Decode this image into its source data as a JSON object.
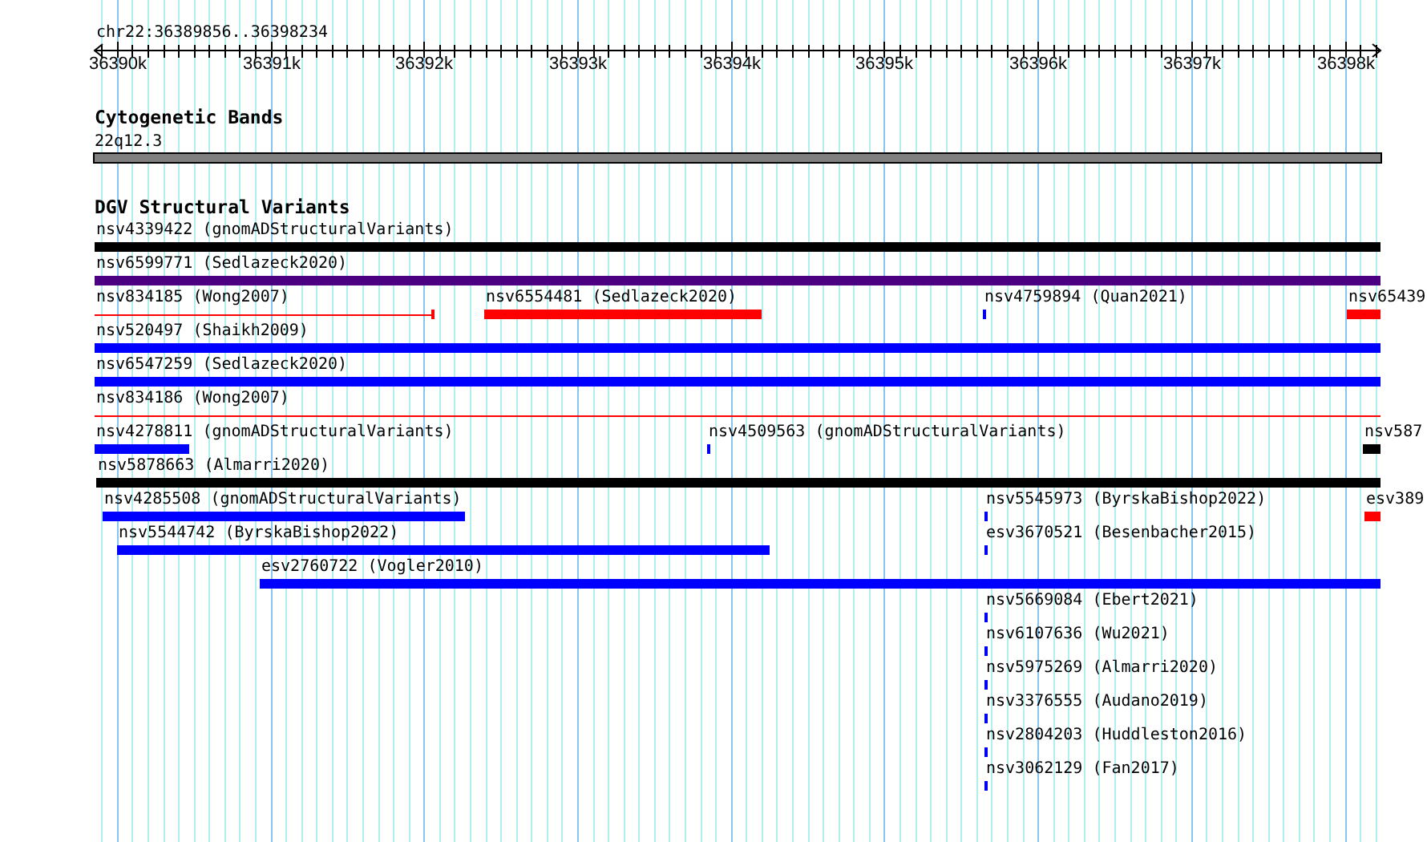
{
  "location": "chr22:36389856..36398234",
  "ruler": {
    "ticks": [
      "36390k",
      "36391k",
      "36392k",
      "36393k",
      "36394k",
      "36395k",
      "36396k",
      "36397k",
      "36398k"
    ]
  },
  "tracks": [
    {
      "kind": "bands",
      "title": "Cytogenetic Bands",
      "bands": [
        {
          "name": "22q12.3"
        }
      ]
    },
    {
      "kind": "features",
      "title": "DGV Structural Variants",
      "rows": [
        {
          "features": [
            {
              "label": "nsv4339422 (gnomADStructuralVariants)",
              "kind": "bar",
              "color": "#000000"
            }
          ]
        },
        {
          "features": [
            {
              "label": "nsv6599771 (Sedlazeck2020)",
              "kind": "bar",
              "color": "#4b0082"
            }
          ]
        },
        {
          "features": [
            {
              "label": "nsv834185 (Wong2007)",
              "kind": "line",
              "color": "#ff0000"
            },
            {
              "label": "nsv6554481 (Sedlazeck2020)",
              "kind": "bar",
              "color": "#ff0000"
            },
            {
              "label": "nsv4759894 (Quan2021)",
              "kind": "bar",
              "color": "#0000ff"
            },
            {
              "label": "nsv65439",
              "kind": "bar",
              "color": "#ff0000"
            }
          ]
        },
        {
          "features": [
            {
              "label": "nsv520497 (Shaikh2009)",
              "kind": "bar",
              "color": "#0000ff"
            }
          ]
        },
        {
          "features": [
            {
              "label": "nsv6547259 (Sedlazeck2020)",
              "kind": "bar",
              "color": "#0000ff"
            }
          ]
        },
        {
          "features": [
            {
              "label": "nsv834186 (Wong2007)",
              "kind": "line",
              "color": "#ff0000"
            }
          ]
        },
        {
          "features": [
            {
              "label": "nsv4278811 (gnomADStructuralVariants)",
              "kind": "bar",
              "color": "#0000ff"
            },
            {
              "label": "nsv4509563 (gnomADStructuralVariants)",
              "kind": "bar",
              "color": "#0000ff"
            },
            {
              "label": "nsv587",
              "kind": "bar",
              "color": "#000000"
            }
          ]
        },
        {
          "features": [
            {
              "label": "nsv5878663 (Almarri2020)",
              "kind": "bar",
              "color": "#000000"
            }
          ]
        },
        {
          "features": [
            {
              "label": "nsv4285508 (gnomADStructuralVariants)",
              "kind": "bar",
              "color": "#0000ff"
            },
            {
              "label": "nsv5545973 (ByrskaBishop2022)",
              "kind": "bar",
              "color": "#0000ff"
            },
            {
              "label": "esv389",
              "kind": "bar",
              "color": "#ff0000"
            }
          ]
        },
        {
          "features": [
            {
              "label": "nsv5544742 (ByrskaBishop2022)",
              "kind": "bar",
              "color": "#0000ff"
            },
            {
              "label": "esv3670521 (Besenbacher2015)",
              "kind": "bar",
              "color": "#0000ff"
            }
          ]
        },
        {
          "features": [
            {
              "label": "esv2760722 (Vogler2010)",
              "kind": "bar",
              "color": "#0000ff"
            }
          ]
        },
        {
          "features": [
            {
              "label": "nsv5669084 (Ebert2021)",
              "kind": "bar",
              "color": "#0000ff"
            }
          ]
        },
        {
          "features": [
            {
              "label": "nsv6107636 (Wu2021)",
              "kind": "bar",
              "color": "#0000ff"
            }
          ]
        },
        {
          "features": [
            {
              "label": "nsv5975269 (Almarri2020)",
              "kind": "bar",
              "color": "#0000ff"
            }
          ]
        },
        {
          "features": [
            {
              "label": "nsv3376555 (Audano2019)",
              "kind": "bar",
              "color": "#0000ff"
            }
          ]
        },
        {
          "features": [
            {
              "label": "nsv2804203 (Huddleston2016)",
              "kind": "bar",
              "color": "#0000ff"
            }
          ]
        },
        {
          "features": [
            {
              "label": "nsv3062129 (Fan2017)",
              "kind": "bar",
              "color": "#0000ff"
            }
          ]
        }
      ]
    }
  ]
}
